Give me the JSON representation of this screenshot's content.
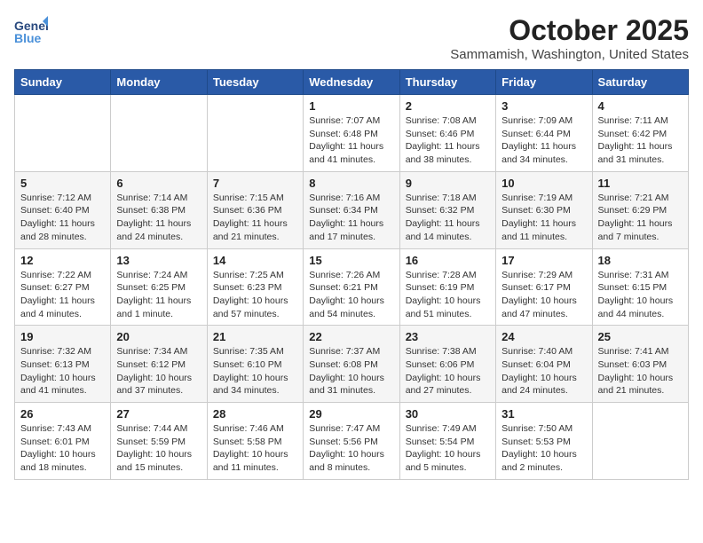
{
  "header": {
    "logo_line1": "General",
    "logo_line2": "Blue",
    "month": "October 2025",
    "location": "Sammamish, Washington, United States"
  },
  "weekdays": [
    "Sunday",
    "Monday",
    "Tuesday",
    "Wednesday",
    "Thursday",
    "Friday",
    "Saturday"
  ],
  "weeks": [
    [
      {
        "day": "",
        "info": ""
      },
      {
        "day": "",
        "info": ""
      },
      {
        "day": "",
        "info": ""
      },
      {
        "day": "1",
        "info": "Sunrise: 7:07 AM\nSunset: 6:48 PM\nDaylight: 11 hours and 41 minutes."
      },
      {
        "day": "2",
        "info": "Sunrise: 7:08 AM\nSunset: 6:46 PM\nDaylight: 11 hours and 38 minutes."
      },
      {
        "day": "3",
        "info": "Sunrise: 7:09 AM\nSunset: 6:44 PM\nDaylight: 11 hours and 34 minutes."
      },
      {
        "day": "4",
        "info": "Sunrise: 7:11 AM\nSunset: 6:42 PM\nDaylight: 11 hours and 31 minutes."
      }
    ],
    [
      {
        "day": "5",
        "info": "Sunrise: 7:12 AM\nSunset: 6:40 PM\nDaylight: 11 hours and 28 minutes."
      },
      {
        "day": "6",
        "info": "Sunrise: 7:14 AM\nSunset: 6:38 PM\nDaylight: 11 hours and 24 minutes."
      },
      {
        "day": "7",
        "info": "Sunrise: 7:15 AM\nSunset: 6:36 PM\nDaylight: 11 hours and 21 minutes."
      },
      {
        "day": "8",
        "info": "Sunrise: 7:16 AM\nSunset: 6:34 PM\nDaylight: 11 hours and 17 minutes."
      },
      {
        "day": "9",
        "info": "Sunrise: 7:18 AM\nSunset: 6:32 PM\nDaylight: 11 hours and 14 minutes."
      },
      {
        "day": "10",
        "info": "Sunrise: 7:19 AM\nSunset: 6:30 PM\nDaylight: 11 hours and 11 minutes."
      },
      {
        "day": "11",
        "info": "Sunrise: 7:21 AM\nSunset: 6:29 PM\nDaylight: 11 hours and 7 minutes."
      }
    ],
    [
      {
        "day": "12",
        "info": "Sunrise: 7:22 AM\nSunset: 6:27 PM\nDaylight: 11 hours and 4 minutes."
      },
      {
        "day": "13",
        "info": "Sunrise: 7:24 AM\nSunset: 6:25 PM\nDaylight: 11 hours and 1 minute."
      },
      {
        "day": "14",
        "info": "Sunrise: 7:25 AM\nSunset: 6:23 PM\nDaylight: 10 hours and 57 minutes."
      },
      {
        "day": "15",
        "info": "Sunrise: 7:26 AM\nSunset: 6:21 PM\nDaylight: 10 hours and 54 minutes."
      },
      {
        "day": "16",
        "info": "Sunrise: 7:28 AM\nSunset: 6:19 PM\nDaylight: 10 hours and 51 minutes."
      },
      {
        "day": "17",
        "info": "Sunrise: 7:29 AM\nSunset: 6:17 PM\nDaylight: 10 hours and 47 minutes."
      },
      {
        "day": "18",
        "info": "Sunrise: 7:31 AM\nSunset: 6:15 PM\nDaylight: 10 hours and 44 minutes."
      }
    ],
    [
      {
        "day": "19",
        "info": "Sunrise: 7:32 AM\nSunset: 6:13 PM\nDaylight: 10 hours and 41 minutes."
      },
      {
        "day": "20",
        "info": "Sunrise: 7:34 AM\nSunset: 6:12 PM\nDaylight: 10 hours and 37 minutes."
      },
      {
        "day": "21",
        "info": "Sunrise: 7:35 AM\nSunset: 6:10 PM\nDaylight: 10 hours and 34 minutes."
      },
      {
        "day": "22",
        "info": "Sunrise: 7:37 AM\nSunset: 6:08 PM\nDaylight: 10 hours and 31 minutes."
      },
      {
        "day": "23",
        "info": "Sunrise: 7:38 AM\nSunset: 6:06 PM\nDaylight: 10 hours and 27 minutes."
      },
      {
        "day": "24",
        "info": "Sunrise: 7:40 AM\nSunset: 6:04 PM\nDaylight: 10 hours and 24 minutes."
      },
      {
        "day": "25",
        "info": "Sunrise: 7:41 AM\nSunset: 6:03 PM\nDaylight: 10 hours and 21 minutes."
      }
    ],
    [
      {
        "day": "26",
        "info": "Sunrise: 7:43 AM\nSunset: 6:01 PM\nDaylight: 10 hours and 18 minutes."
      },
      {
        "day": "27",
        "info": "Sunrise: 7:44 AM\nSunset: 5:59 PM\nDaylight: 10 hours and 15 minutes."
      },
      {
        "day": "28",
        "info": "Sunrise: 7:46 AM\nSunset: 5:58 PM\nDaylight: 10 hours and 11 minutes."
      },
      {
        "day": "29",
        "info": "Sunrise: 7:47 AM\nSunset: 5:56 PM\nDaylight: 10 hours and 8 minutes."
      },
      {
        "day": "30",
        "info": "Sunrise: 7:49 AM\nSunset: 5:54 PM\nDaylight: 10 hours and 5 minutes."
      },
      {
        "day": "31",
        "info": "Sunrise: 7:50 AM\nSunset: 5:53 PM\nDaylight: 10 hours and 2 minutes."
      },
      {
        "day": "",
        "info": ""
      }
    ]
  ]
}
